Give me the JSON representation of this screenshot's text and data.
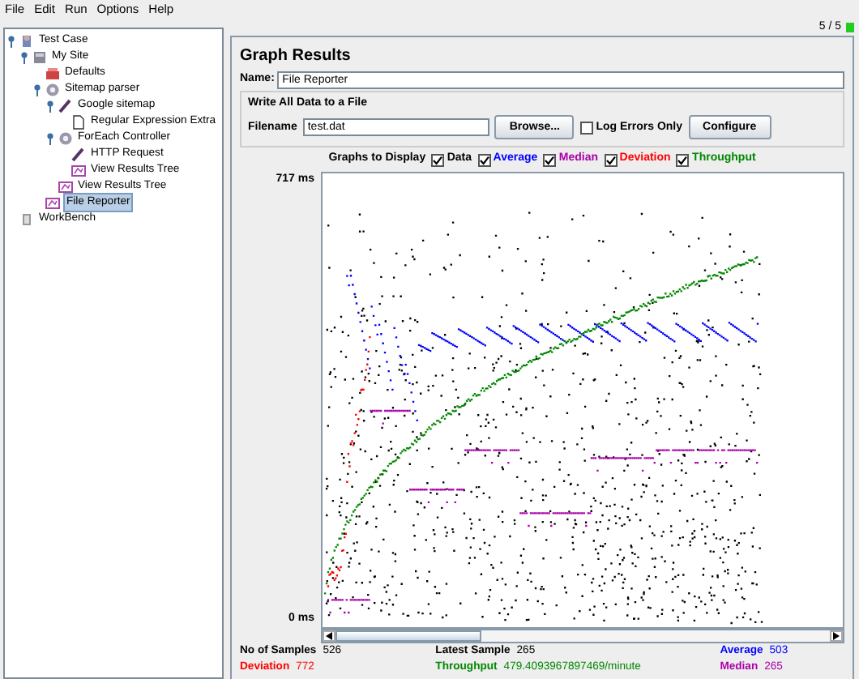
{
  "menu": [
    "File",
    "Edit",
    "Run",
    "Options",
    "Help"
  ],
  "tree": [
    {
      "label": "Test Case",
      "kind": "plan",
      "expanded": true,
      "selected": false,
      "children": [
        {
          "label": "My Site",
          "kind": "group",
          "expanded": true,
          "selected": false,
          "children": [
            {
              "label": "Defaults",
              "kind": "config",
              "selected": false
            },
            {
              "label": "Sitemap parser",
              "kind": "controller",
              "expanded": true,
              "selected": false,
              "children": [
                {
                  "label": "Google sitemap",
                  "kind": "sampler",
                  "expanded": true,
                  "selected": false,
                  "children": [
                    {
                      "label": "Regular Expression Extra",
                      "kind": "extractor",
                      "selected": false
                    }
                  ]
                },
                {
                  "label": "ForEach Controller",
                  "kind": "controller",
                  "expanded": true,
                  "selected": false,
                  "children": [
                    {
                      "label": "HTTP Request",
                      "kind": "sampler",
                      "selected": false
                    },
                    {
                      "label": "View Results Tree",
                      "kind": "listener",
                      "selected": false
                    }
                  ]
                },
                {
                  "label": "View Results Tree",
                  "kind": "listener",
                  "selected": false
                }
              ]
            },
            {
              "label": "File Reporter",
              "kind": "listener",
              "selected": true
            }
          ]
        }
      ]
    },
    {
      "label": "WorkBench",
      "kind": "bench",
      "selected": false
    }
  ],
  "status": {
    "counter": "5 / 5"
  },
  "panel": {
    "title": "Graph Results",
    "name_label": "Name:",
    "name_value": "File Reporter",
    "file_group": {
      "title": "Write All Data to a File",
      "filename_label": "Filename",
      "filename_value": "test.dat",
      "browse": "Browse...",
      "log_errors": {
        "label": "Log Errors Only",
        "checked": false
      },
      "configure": "Configure"
    },
    "graphs_label": "Graphs to Display",
    "graphs": [
      {
        "label": "Data",
        "kind": "data",
        "checked": true,
        "color": "#000000"
      },
      {
        "label": "Average",
        "kind": "average",
        "checked": true,
        "color": "#0000ff"
      },
      {
        "label": "Median",
        "kind": "median",
        "checked": true,
        "color": "#aa00aa"
      },
      {
        "label": "Deviation",
        "kind": "deviation",
        "checked": true,
        "color": "#ff0000"
      },
      {
        "label": "Throughput",
        "kind": "throughput",
        "checked": true,
        "color": "#008800"
      }
    ],
    "y_max": "717 ms",
    "y_min": "0 ms",
    "stats": [
      [
        {
          "label": "No of Samples",
          "value": "526",
          "color": "#000000"
        },
        {
          "label": "Latest Sample",
          "value": "265",
          "color": "#000000"
        },
        {
          "label": "Average",
          "value": "503",
          "color": "#0000ff"
        }
      ],
      [
        {
          "label": "Deviation",
          "value": "772",
          "color": "#ff0000"
        },
        {
          "label": "Throughput",
          "value": "479.4093967897469/minute",
          "color": "#008800"
        },
        {
          "label": "Median",
          "value": "265",
          "color": "#aa00aa"
        }
      ]
    ]
  }
}
